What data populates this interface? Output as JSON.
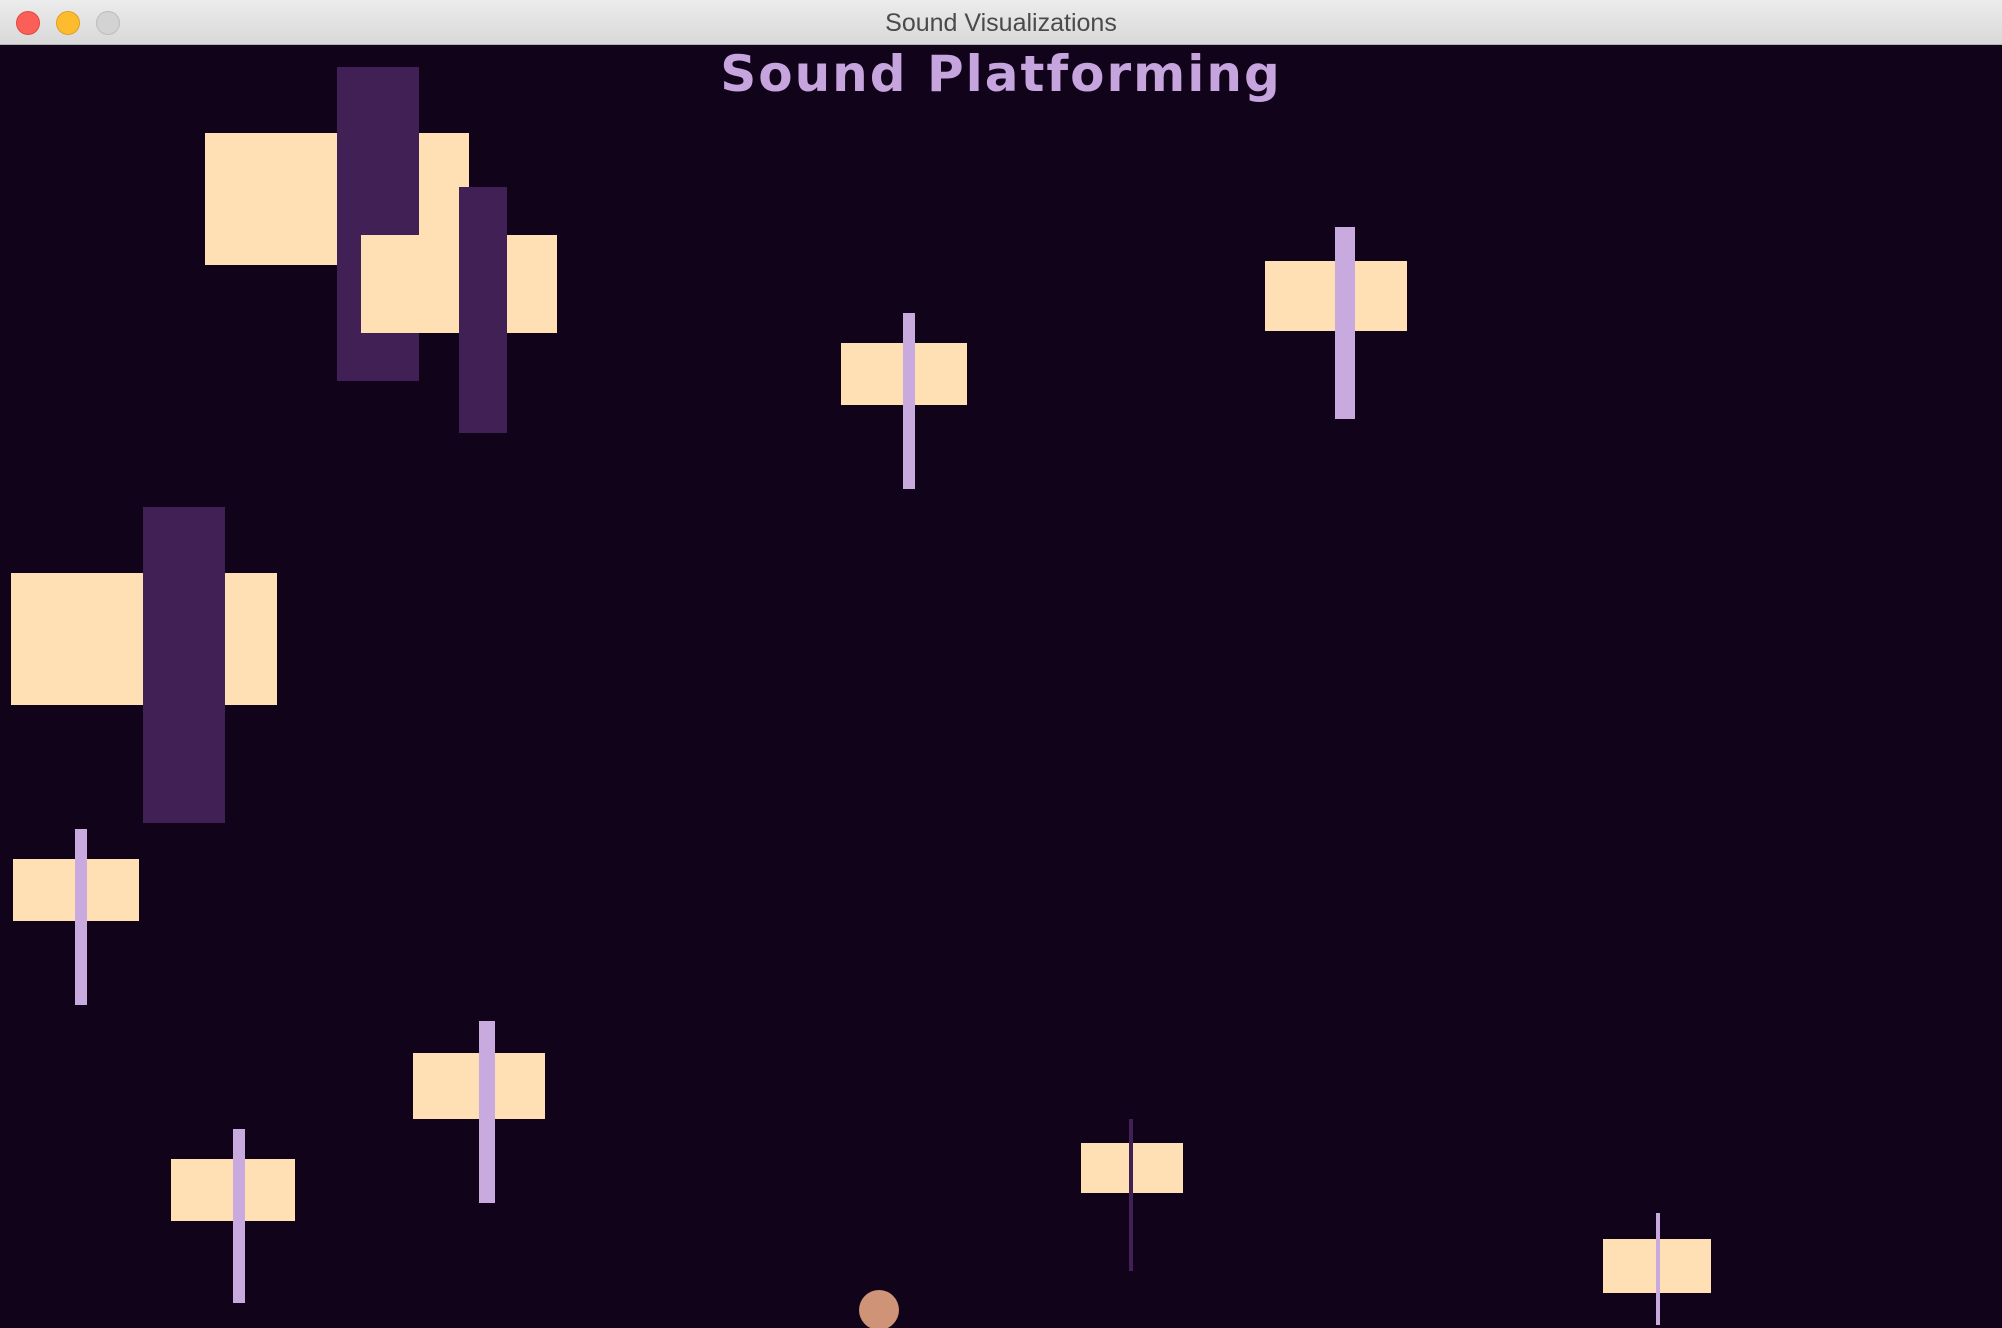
{
  "window": {
    "title": "Sound Visualizations",
    "buttons": [
      "close",
      "minimize",
      "zoom"
    ]
  },
  "game": {
    "title": "Sound Platforming"
  },
  "colors": {
    "background": "#110319",
    "platform": "#ffe0b4",
    "bar_dark": "#412155",
    "bar_light": "#c8aadf",
    "player": "#cf9377",
    "title": "#c6a5de"
  },
  "icons": {
    "close": "close-icon",
    "minimize": "minimize-icon",
    "zoom": "zoom-icon"
  }
}
